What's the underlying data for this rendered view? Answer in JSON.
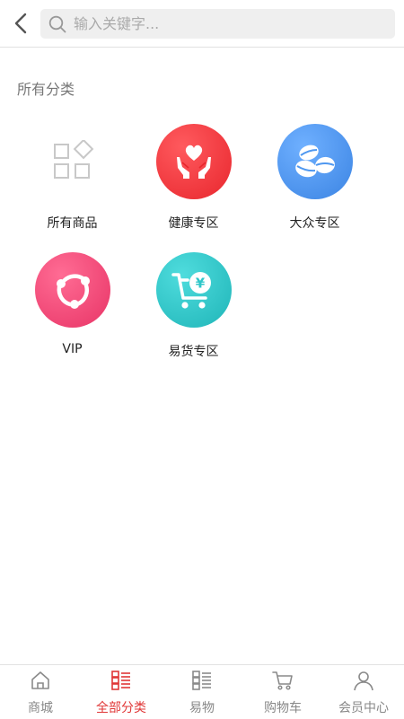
{
  "header": {
    "search_placeholder": "输入关键字..."
  },
  "section_title": "所有分类",
  "categories": [
    {
      "label": "所有商品",
      "icon": "grid-diamond-icon"
    },
    {
      "label": "健康专区",
      "icon": "heart-in-hands-icon",
      "color": "#f23a40"
    },
    {
      "label": "大众专区",
      "icon": "coffee-beans-icon",
      "color": "#4f98f0"
    },
    {
      "label": "VIP",
      "icon": "share-nodes-icon",
      "color": "#f0487a"
    },
    {
      "label": "易货专区",
      "icon": "yuan-cart-icon",
      "color": "#2ec7c9"
    }
  ],
  "tabbar": {
    "active_color": "#e03737",
    "items": [
      {
        "label": "商城",
        "icon": "home-icon",
        "active": false
      },
      {
        "label": "全部分类",
        "icon": "category-list-icon",
        "active": true
      },
      {
        "label": "易物",
        "icon": "category-list-icon",
        "active": false
      },
      {
        "label": "购物车",
        "icon": "cart-icon",
        "active": false
      },
      {
        "label": "会员中心",
        "icon": "user-icon",
        "active": false
      }
    ]
  }
}
